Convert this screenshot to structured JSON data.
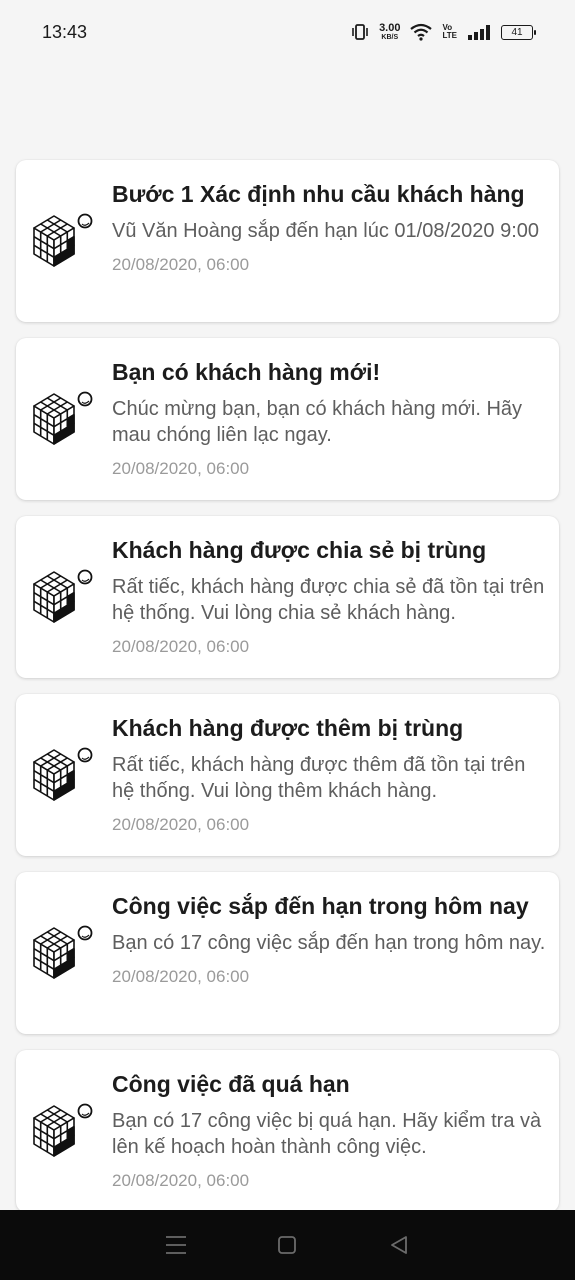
{
  "status_bar": {
    "time": "13:43",
    "net_speed_value": "3.00",
    "net_speed_unit": "KB/S",
    "volte_top": "Vo",
    "volte_bottom": "LTE",
    "battery": "41",
    "icons": [
      "vibrate-icon",
      "wifi-icon",
      "signal-icon",
      "battery-icon"
    ]
  },
  "notifications": [
    {
      "title": "Bước 1 Xác định nhu cầu khách hàng",
      "body": "Vũ Văn Hoàng sắp đến hạn lúc 01/08/2020 9:00",
      "time": "20/08/2020, 06:00",
      "icon": "cube-icon"
    },
    {
      "title": "Bạn có khách hàng mới!",
      "body": "Chúc mừng bạn, bạn có khách hàng mới. Hãy mau chóng liên lạc ngay.",
      "time": "20/08/2020, 06:00",
      "icon": "cube-icon"
    },
    {
      "title": "Khách hàng được chia sẻ bị trùng",
      "body": "Rất tiếc, khách hàng được chia sẻ đã tồn tại trên hệ thống. Vui lòng chia sẻ khách hàng.",
      "time": "20/08/2020, 06:00",
      "icon": "cube-icon"
    },
    {
      "title": "Khách hàng được thêm bị trùng",
      "body": "Rất tiếc, khách hàng được thêm đã tồn tại trên hệ thống. Vui lòng thêm khách hàng.",
      "time": "20/08/2020, 06:00",
      "icon": "cube-icon"
    },
    {
      "title": "Công việc sắp đến hạn trong hôm nay",
      "body": "Bạn có 17 công việc sắp đến hạn trong hôm nay.",
      "time": "20/08/2020, 06:00",
      "icon": "cube-icon"
    },
    {
      "title": "Công việc đã quá hạn",
      "body": "Bạn có 17 công việc bị quá hạn. Hãy kiểm tra và lên kế hoạch hoàn thành công việc.",
      "time": "20/08/2020, 06:00",
      "icon": "cube-icon"
    }
  ],
  "nav_bar": {
    "buttons": [
      "menu-icon",
      "home-icon",
      "back-icon"
    ]
  }
}
